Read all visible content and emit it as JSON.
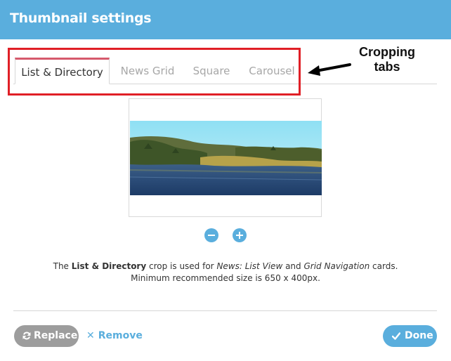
{
  "dialog": {
    "title": "Thumbnail settings"
  },
  "tabs": [
    {
      "label": "List & Directory",
      "active": true
    },
    {
      "label": "News Grid",
      "active": false
    },
    {
      "label": "Square",
      "active": false
    },
    {
      "label": "Carousel",
      "active": false
    }
  ],
  "annotation": {
    "line1": "Cropping",
    "line2": "tabs"
  },
  "caption": {
    "p1": "The ",
    "crop_name": "List & Directory",
    "p2": " crop is used for ",
    "use1": "News: List View",
    "p3": " and ",
    "use2": "Grid Navigation",
    "p4": " cards.",
    "line2": "Minimum recommended size is 650 x 400px."
  },
  "footer": {
    "replace_label": "Replace",
    "remove_label": "Remove",
    "done_label": "Done"
  },
  "icons": {
    "zoom_out": "minus-circle-icon",
    "zoom_in": "plus-circle-icon",
    "replace": "refresh-icon",
    "remove": "close-icon",
    "done": "check-icon"
  },
  "colors": {
    "header": "#5aaedd",
    "active_tab_accent": "#d65a6c",
    "annotation_red": "#e01f26",
    "replace_button": "#9d9d9d",
    "done_button": "#5aaedd"
  }
}
